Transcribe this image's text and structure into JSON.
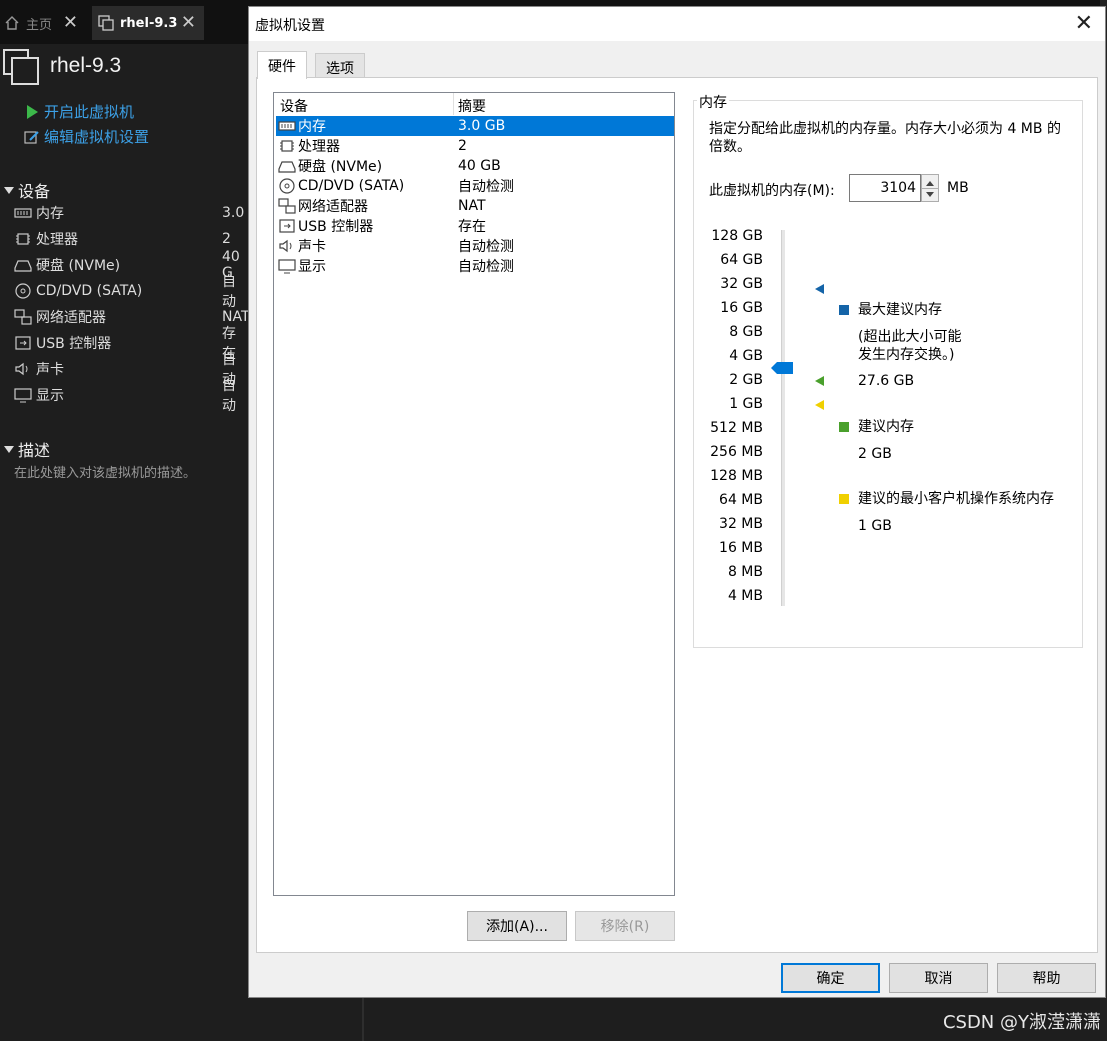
{
  "app": {
    "tabs": [
      {
        "label": "主页"
      },
      {
        "label": "rhel-9.3"
      }
    ],
    "vm_title": "rhel-9.3",
    "actions": [
      {
        "label": "开启此虚拟机"
      },
      {
        "label": "编辑虚拟机设置"
      }
    ],
    "devices_section": "设备",
    "devices": [
      {
        "name": "内存",
        "value": "3.0"
      },
      {
        "name": "处理器",
        "value": "2"
      },
      {
        "name": "硬盘 (NVMe)",
        "value": "40 G"
      },
      {
        "name": "CD/DVD (SATA)",
        "value": "自动"
      },
      {
        "name": "网络适配器",
        "value": "NAT"
      },
      {
        "name": "USB 控制器",
        "value": "存在"
      },
      {
        "name": "声卡",
        "value": "自动"
      },
      {
        "name": "显示",
        "value": "自动"
      }
    ],
    "desc_section": "描述",
    "desc_placeholder": "在此处键入对该虚拟机的描述。"
  },
  "dialog": {
    "title": "虚拟机设置",
    "tabs": [
      {
        "label": "硬件"
      },
      {
        "label": "选项"
      }
    ],
    "device_list": {
      "col_device": "设备",
      "col_summary": "摘要",
      "selected_index": 0,
      "rows": [
        {
          "device": "内存",
          "summary": "3.0 GB",
          "icon": "memory-icon"
        },
        {
          "device": "处理器",
          "summary": "2",
          "icon": "processor-icon"
        },
        {
          "device": "硬盘 (NVMe)",
          "summary": "40 GB",
          "icon": "hard-disk-icon"
        },
        {
          "device": "CD/DVD (SATA)",
          "summary": "自动检测",
          "icon": "cd-dvd-icon"
        },
        {
          "device": "网络适配器",
          "summary": "NAT",
          "icon": "network-adapter-icon"
        },
        {
          "device": "USB 控制器",
          "summary": "存在",
          "icon": "usb-icon"
        },
        {
          "device": "声卡",
          "summary": "自动检测",
          "icon": "sound-card-icon"
        },
        {
          "device": "显示",
          "summary": "自动检测",
          "icon": "display-icon"
        }
      ]
    },
    "add_button": "添加(A)...",
    "remove_button": "移除(R)",
    "memory": {
      "group_label": "内存",
      "description": "指定分配给此虚拟机的内存量。内存大小必须为 4 MB 的倍数。",
      "input_label": "此虚拟机的内存(M):",
      "input_value": "3104",
      "unit": "MB",
      "scale": [
        "128 GB",
        "64 GB",
        "32 GB",
        "16 GB",
        "8 GB",
        "4 GB",
        "2 GB",
        "1 GB",
        "512 MB",
        "256 MB",
        "128 MB",
        "64 MB",
        "32 MB",
        "16 MB",
        "8 MB",
        "4 MB"
      ],
      "legend": {
        "max_title": "最大建议内存",
        "max_note_1": "(超出此大小可能",
        "max_note_2": "发生内存交换。)",
        "max_value": "27.6 GB",
        "rec_title": "建议内存",
        "rec_value": "2 GB",
        "min_title": "建议的最小客户机操作系统内存",
        "min_value": "1 GB"
      },
      "colors": {
        "max": "#1464a8",
        "recommended": "#4aa02c",
        "minimum": "#f0d000",
        "thumb": "#0078d7"
      }
    },
    "ok_button": "确定",
    "cancel_button": "取消",
    "help_button": "帮助"
  },
  "watermark": "CSDN @Y淑滢潇潇"
}
